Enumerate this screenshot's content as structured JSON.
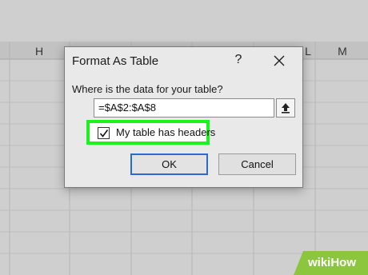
{
  "spreadsheet": {
    "column_headers": [
      "H",
      "L",
      "M"
    ]
  },
  "dialog": {
    "title": "Format As Table",
    "help_label": "?",
    "close_icon": "close-icon",
    "prompt": "Where is the data for your table?",
    "range_value": "=$A$2:$A$8",
    "collapse_icon": "collapse-upload-icon",
    "checkbox_label": "My table has headers",
    "checkbox_checked": true,
    "ok_label": "OK",
    "cancel_label": "Cancel"
  },
  "colors": {
    "highlight": "#1cf21c",
    "ok_border": "#2b6bd1",
    "watermark": "#8cc63f"
  },
  "watermark": {
    "text": "wikiHow"
  }
}
